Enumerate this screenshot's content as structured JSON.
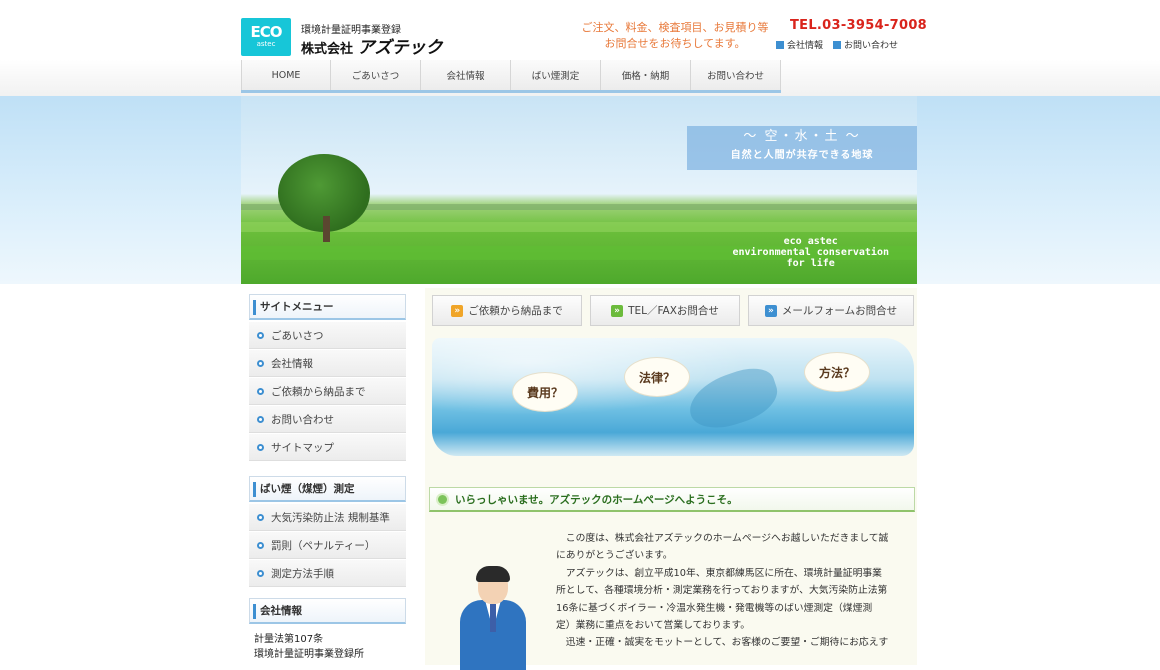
{
  "header": {
    "logo_eco": "ECO",
    "logo_astec": "astec",
    "company_sub": "環境計量証明事業登録",
    "company_prefix": "株式会社",
    "company_name": "アズテック",
    "inquiry_line1": "ご注文、料金、検査項目、お見積り等",
    "inquiry_line2": "お問合せをお待ちしてます。",
    "tel": "TEL.03-3954-7008",
    "links": [
      "会社情報",
      "お問い合わせ"
    ]
  },
  "nav": [
    "HOME",
    "ごあいさつ",
    "会社情報",
    "ばい煙測定",
    "価格・納期",
    "お問い合わせ"
  ],
  "hero": {
    "caption_line1": "〜 空・水・土 〜",
    "caption_line2": "自然と人間が共存できる地球",
    "eng_line1": "eco astec",
    "eng_line2": "environmental conservation",
    "eng_line3": "for life"
  },
  "sidebar": {
    "menu_title": "サイトメニュー",
    "menu_items": [
      "ごあいさつ",
      "会社情報",
      "ご依頼から納品まで",
      "お問い合わせ",
      "サイトマップ"
    ],
    "smoke_title": "ばい煙（煤煙）測定",
    "smoke_items": [
      "大気汚染防止法 規制基準",
      "罰則（ペナルティー）",
      "測定方法手順"
    ],
    "info_title": "会社情報",
    "info_line1": "計量法第107条",
    "info_line2": "環境計量証明事業登録所"
  },
  "main": {
    "tabs": [
      "ご依頼から納品まで",
      "TEL／FAXお問合せ",
      "メールフォームお問合せ"
    ],
    "bubbles": [
      "費用？",
      "法律？",
      "方法？"
    ],
    "greeting": "いらっしゃいませ。アズテックのホームページへようこそ。",
    "paragraphs": [
      "　この度は、株式会社アズテックのホームページへお越しいただきまして誠",
      "にありがとうございます。",
      "　アズテックは、創立平成10年、東京都練馬区に所在、環境計量証明事業",
      "所として、各種環境分析・測定業務を行っておりますが、大気汚染防止法第",
      "16条に基づくボイラー・冷温水発生機・発電機等のばい煙測定（煤煙測",
      "定）業務に重点をおいて営業しております。",
      "　迅速・正確・誠実をモットーとして、お客様のご要望・ご期待にお応えす"
    ]
  },
  "colors": {
    "accent_blue": "#3d8fd1",
    "logo_cyan": "#17c6d8",
    "tel_red": "#d9241c",
    "inquiry_orange": "#e8793a",
    "greeting_green": "#2a6e1e"
  }
}
